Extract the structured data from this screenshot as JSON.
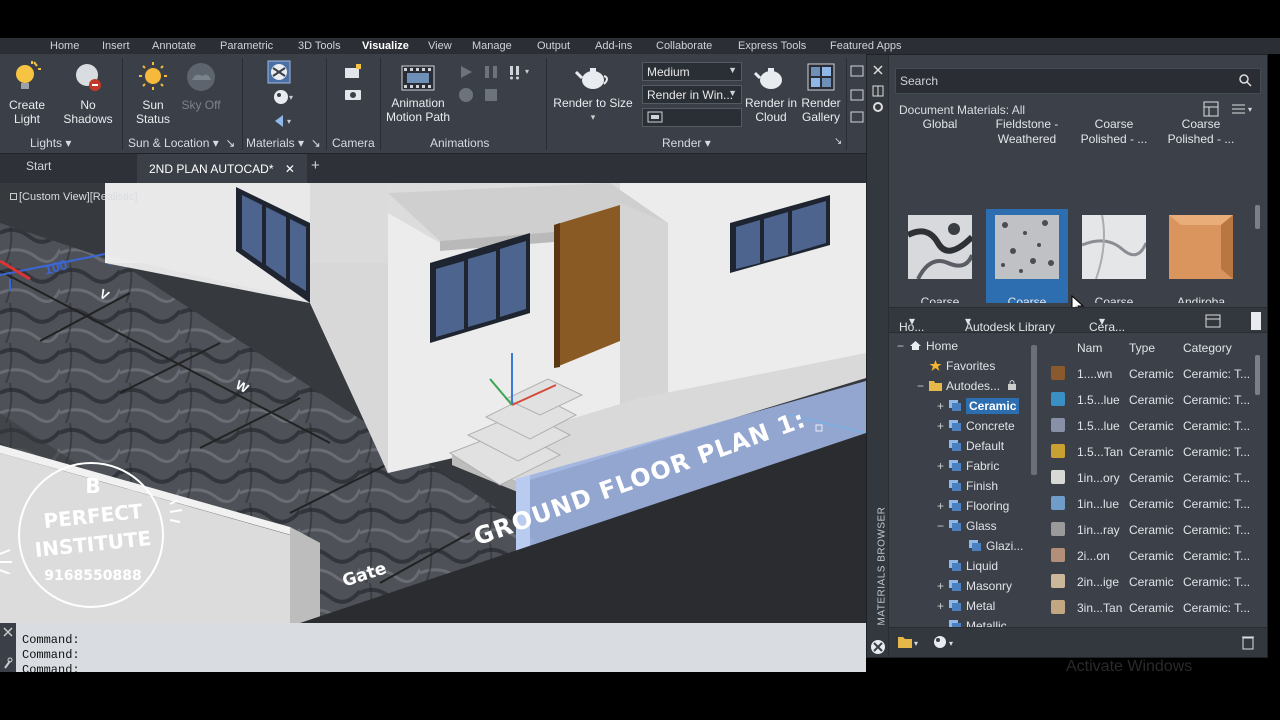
{
  "ribbon_tabs": [
    "Home",
    "Insert",
    "Annotate",
    "Parametric",
    "3D Tools",
    "Visualize",
    "View",
    "Manage",
    "Output",
    "Add-ins",
    "Collaborate",
    "Express Tools",
    "Featured Apps"
  ],
  "ribbon": {
    "lights": {
      "create_light": "Create\nLight",
      "no_shadows": "No\nShadows",
      "panel": "Lights"
    },
    "sun": {
      "sun_status": "Sun\nStatus",
      "sky_off": "Sky Off",
      "panel": "Sun & Location"
    },
    "materials": {
      "panel": "Materials"
    },
    "camera": {
      "panel": "Camera"
    },
    "animations": {
      "motion_path": "Animation\nMotion Path",
      "panel": "Animations"
    },
    "render": {
      "render_to_size": "Render to Size",
      "preset": "Medium",
      "render_in": "Render in Win...",
      "render_cloud": "Render in\nCloud",
      "render_gallery": "Render\nGallery",
      "panel": "Render"
    }
  },
  "file_tabs": {
    "start": "Start",
    "active": "2ND PLAN AUTOCAD*",
    "add": "+"
  },
  "viewport": {
    "label": "[Custom View][Realistic]",
    "dimension": "100",
    "letter_v": "V",
    "letter_w": "W",
    "gate": "Gate",
    "plan_title": "GROUND FLOOR PLAN 1:"
  },
  "logo": {
    "line1": "B",
    "line2": "PERFECT",
    "line3": "INSTITUTE",
    "phone": "9168550888"
  },
  "command_lines": [
    "Command:",
    "Command:",
    "Command:"
  ],
  "materials_browser": {
    "side_label": "MATERIALS BROWSER",
    "search_placeholder": "Search",
    "doc_materials": "Document Materials: All",
    "top_row": [
      "Global",
      "Fieldstone -\nWeathered",
      "Coarse\nPolished - ...",
      "Coarse\nPolished - ..."
    ],
    "mid_row": [
      {
        "name": "Coarse\nPolished - ...",
        "selected": false,
        "swatch": "granite-light"
      },
      {
        "name": "Coarse\nPolished - ...",
        "selected": true,
        "swatch": "granite-speckle"
      },
      {
        "name": "Coarse\nPolished - ...",
        "selected": false,
        "swatch": "granite-pale"
      },
      {
        "name": "Andiroba",
        "selected": false,
        "swatch": "wood"
      }
    ],
    "library_bar": {
      "home": "Ho...",
      "library": "Autodesk Library",
      "category": "Cera..."
    },
    "tree": [
      {
        "label": "Home",
        "level": 0,
        "pm": "−",
        "icon": "home"
      },
      {
        "label": "Favorites",
        "level": 1,
        "pm": "",
        "icon": "star"
      },
      {
        "label": "Autodes...",
        "level": 1,
        "pm": "−",
        "icon": "folder",
        "locked": true
      },
      {
        "label": "Ceramic",
        "level": 2,
        "pm": "+",
        "icon": "mat",
        "selected": true
      },
      {
        "label": "Concrete",
        "level": 2,
        "pm": "+",
        "icon": "mat"
      },
      {
        "label": "Default",
        "level": 2,
        "pm": "",
        "icon": "mat"
      },
      {
        "label": "Fabric",
        "level": 2,
        "pm": "+",
        "icon": "mat"
      },
      {
        "label": "Finish",
        "level": 2,
        "pm": "",
        "icon": "mat"
      },
      {
        "label": "Flooring",
        "level": 2,
        "pm": "+",
        "icon": "mat"
      },
      {
        "label": "Glass",
        "level": 2,
        "pm": "−",
        "icon": "mat"
      },
      {
        "label": "Glazi...",
        "level": 3,
        "pm": "",
        "icon": "mat"
      },
      {
        "label": "Liquid",
        "level": 2,
        "pm": "",
        "icon": "mat"
      },
      {
        "label": "Masonry",
        "level": 2,
        "pm": "+",
        "icon": "mat"
      },
      {
        "label": "Metal",
        "level": 2,
        "pm": "+",
        "icon": "mat"
      },
      {
        "label": "Metallic ...",
        "level": 2,
        "pm": "",
        "icon": "mat"
      }
    ],
    "list_headers": {
      "name": "Nam",
      "type": "Type",
      "category": "Category"
    },
    "list_rows": [
      {
        "name": "1....wn",
        "type": "Ceramic",
        "category": "Ceramic: T...",
        "color": "#8a5a2e"
      },
      {
        "name": "1.5...lue",
        "type": "Ceramic",
        "category": "Ceramic: T...",
        "color": "#3a8fc4"
      },
      {
        "name": "1.5...lue",
        "type": "Ceramic",
        "category": "Ceramic: T...",
        "color": "#8790a6"
      },
      {
        "name": "1.5...Tan",
        "type": "Ceramic",
        "category": "Ceramic: T...",
        "color": "#c9a032"
      },
      {
        "name": "1in...ory",
        "type": "Ceramic",
        "category": "Ceramic: T...",
        "color": "#d8d8d4"
      },
      {
        "name": "1in...lue",
        "type": "Ceramic",
        "category": "Ceramic: T...",
        "color": "#6f9cc8"
      },
      {
        "name": "1in...ray",
        "type": "Ceramic",
        "category": "Ceramic: T...",
        "color": "#9a9a9a"
      },
      {
        "name": "2i...on",
        "type": "Ceramic",
        "category": "Ceramic: T...",
        "color": "#b38f7a"
      },
      {
        "name": "2in...ige",
        "type": "Ceramic",
        "category": "Ceramic: T...",
        "color": "#cbb79a"
      },
      {
        "name": "3in...Tan",
        "type": "Ceramic",
        "category": "Ceramic: T...",
        "color": "#c3a682"
      }
    ]
  },
  "watermark": "Activate Windows",
  "colors": {
    "accent": "#2d6eb0",
    "panel": "#3b4048",
    "viewport": "#35393f"
  }
}
